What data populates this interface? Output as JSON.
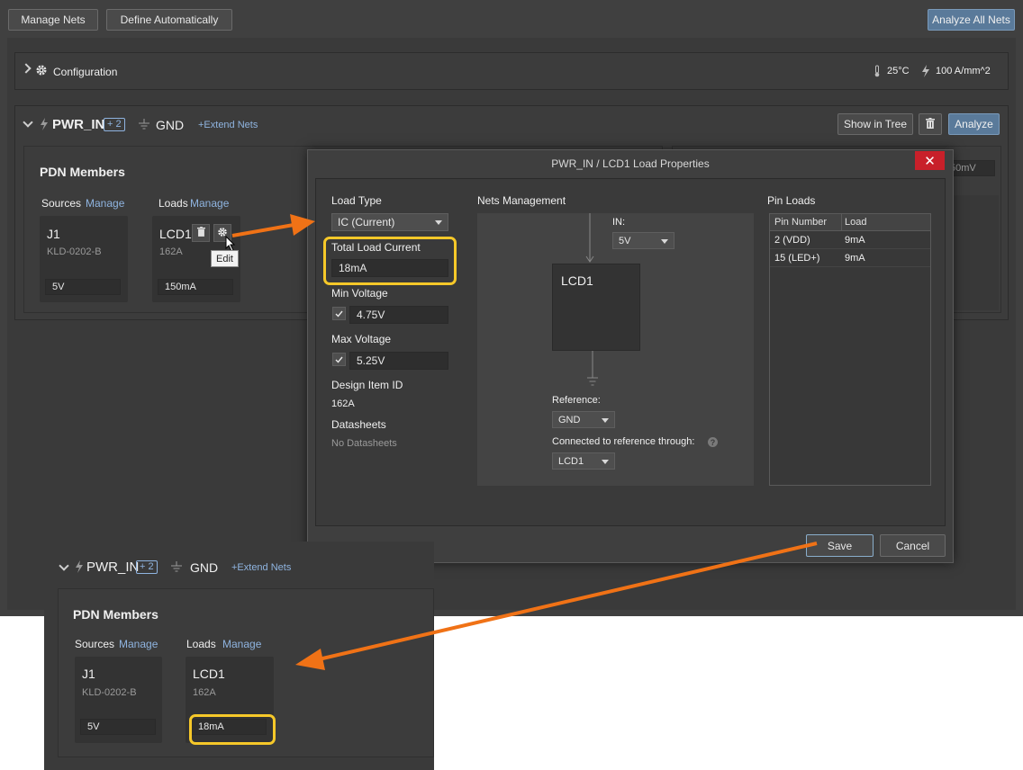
{
  "toolbar": {
    "manage_nets": "Manage Nets",
    "define_automatically": "Define Automatically",
    "analyze_all_nets": "Analyze All Nets"
  },
  "configuration": {
    "label": "Configuration",
    "temperature": "25°C",
    "current_density": "100 A/mm^2"
  },
  "net_group": {
    "primary_net": "PWR_IN",
    "extra_count": "+ 2",
    "reference_net": "GND",
    "extend_nets": "+Extend Nets",
    "show_in_tree": "Show in Tree",
    "analyze": "Analyze"
  },
  "pdn": {
    "title": "PDN Members",
    "sources_label": "Sources",
    "loads_label": "Loads",
    "manage": "Manage",
    "source": {
      "name": "J1",
      "part": "KLD-0202-B",
      "value": "5V"
    },
    "load": {
      "name": "LCD1",
      "part": "162A",
      "value": "150mA"
    },
    "edit_tooltip": "Edit",
    "right_card_value": "50mV"
  },
  "dialog": {
    "title": "PWR_IN / LCD1 Load Properties",
    "close": "✕",
    "load_type_label": "Load Type",
    "load_type_value": "IC (Current)",
    "total_load_current_label": "Total Load Current",
    "total_load_current_value": "18mA",
    "min_voltage_label": "Min Voltage",
    "min_voltage_value": "4.75V",
    "max_voltage_label": "Max Voltage",
    "max_voltage_value": "5.25V",
    "design_item_id_label": "Design Item ID",
    "design_item_id_value": "162A",
    "datasheets_label": "Datasheets",
    "datasheets_value": "No Datasheets",
    "nets_management_label": "Nets Management",
    "in_label": "IN:",
    "in_value": "5V",
    "component_name": "LCD1",
    "reference_label": "Reference:",
    "reference_value": "GND",
    "connected_label": "Connected to reference through:",
    "connected_value": "LCD1",
    "pin_loads_label": "Pin Loads",
    "pin_loads_columns": [
      "Pin Number",
      "Load"
    ],
    "pin_loads_rows": [
      {
        "pin": "2 (VDD)",
        "load": "9mA"
      },
      {
        "pin": "15 (LED+)",
        "load": "9mA"
      }
    ],
    "save": "Save",
    "cancel": "Cancel"
  },
  "result": {
    "primary_net": "PWR_IN",
    "extra_count": "+ 2",
    "reference_net": "GND",
    "extend_nets": "+Extend Nets",
    "title": "PDN Members",
    "sources_label": "Sources",
    "loads_label": "Loads",
    "manage": "Manage",
    "source": {
      "name": "J1",
      "part": "KLD-0202-B",
      "value": "5V"
    },
    "load": {
      "name": "LCD1",
      "part": "162A",
      "value": "18mA"
    }
  },
  "colors": {
    "highlight": "#f6c829",
    "arrow": "#f07216",
    "link": "#8fb4e0",
    "close": "#c8202a"
  }
}
